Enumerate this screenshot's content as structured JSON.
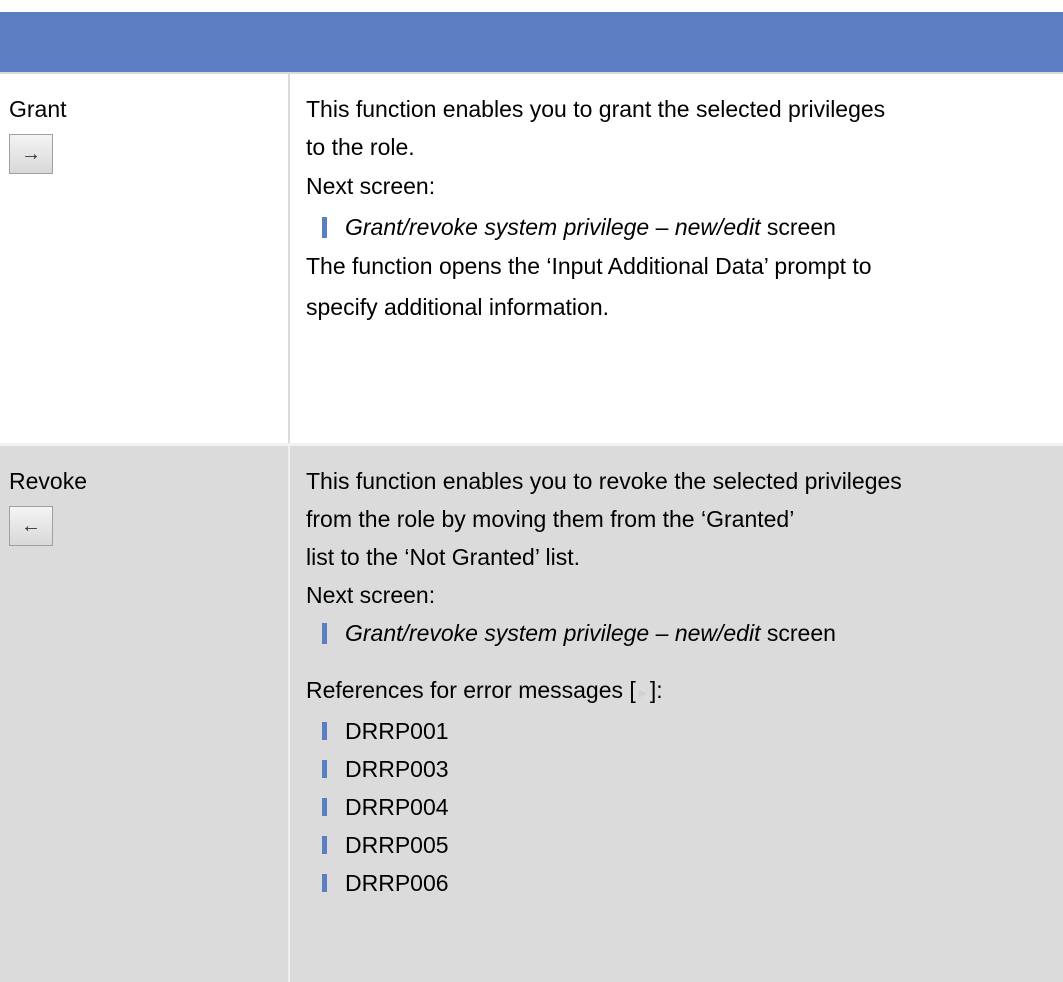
{
  "functions": [
    {
      "name": "Grant",
      "button_icon": "arrow-right-icon",
      "button_glyph": "→",
      "lines": [
        "This function enables you to grant the selected privileges",
        "to the role."
      ],
      "next_screen_label": "Next screen:",
      "next_screen_italic_1": "Grant/revoke system privilege",
      "next_screen_dash": " – ",
      "next_screen_italic_2": "new/edit",
      "next_screen_suffix": " screen",
      "extra_lines": [
        "The function opens the ‘Input Additional Data’ prompt to",
        "specify additional information."
      ]
    },
    {
      "name": "Revoke",
      "button_icon": "arrow-left-icon",
      "button_glyph": "←",
      "lines": [
        "This function enables you to revoke the selected privileges",
        "from the role by moving them from the ‘Granted’",
        "list to the ‘Not Granted’ list."
      ],
      "next_screen_label": "Next screen:",
      "next_screen_italic_1": "Grant/revoke system privilege",
      "next_screen_dash": " – ",
      "next_screen_italic_2": "new/edit",
      "next_screen_suffix": " screen",
      "references_prefix": "References for error messages [",
      "references_suffix": "]:",
      "references_icon": "reference-arrow-icon",
      "error_codes": [
        "DRRP001",
        "DRRP003",
        "DRRP004",
        "DRRP005",
        "DRRP006"
      ]
    }
  ],
  "colors": {
    "header": "#5b7ec3",
    "bullet": "#5b7ec3",
    "revoke_row_bg": "#dbdbdb"
  }
}
